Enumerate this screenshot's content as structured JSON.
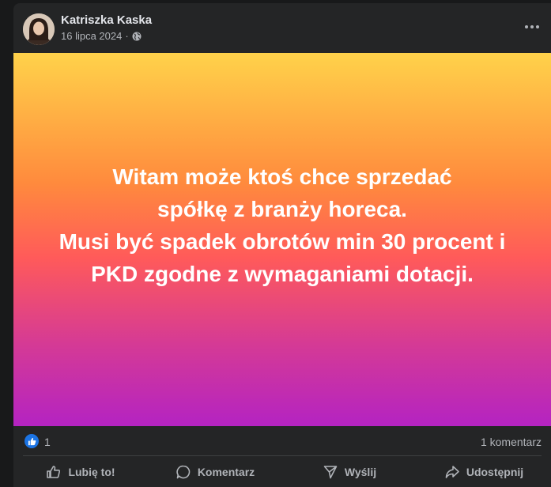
{
  "post": {
    "author": "Katriszka Kaska",
    "date": "16 lipca 2024",
    "separator": "·",
    "text": "Witam może ktoś chce sprzedać\nspółkę z branży horeca.\nMusi być spadek obrotów min 30 procent i\nPKD zgodne z wymaganiami dotacji.",
    "text_lines": [
      "Witam może ktoś chce sprzedać",
      "spółkę z branży horeca.",
      "Musi być spadek obrotów min 30 procent i",
      "PKD zgodne z wymaganiami dotacji."
    ],
    "background_colors": [
      "#ffd24a",
      "#ff8a3d",
      "#ff5a5a",
      "#d53a95",
      "#b423c2"
    ]
  },
  "stats": {
    "likes": "1",
    "comments": "1 komentarz"
  },
  "actions": {
    "like": "Lubię to!",
    "comment": "Komentarz",
    "send": "Wyślij",
    "share": "Udostępnij"
  },
  "icons": {
    "privacy": "globe-icon",
    "menu": "more-options-icon",
    "like_badge": "thumbs-up-icon",
    "like": "thumbs-up-icon",
    "comment": "speech-bubble-icon",
    "send": "send-icon",
    "share": "share-arrow-icon"
  },
  "colors": {
    "card": "#242526",
    "text_secondary": "#b0b3b8",
    "like_blue": "#1b74e4"
  }
}
